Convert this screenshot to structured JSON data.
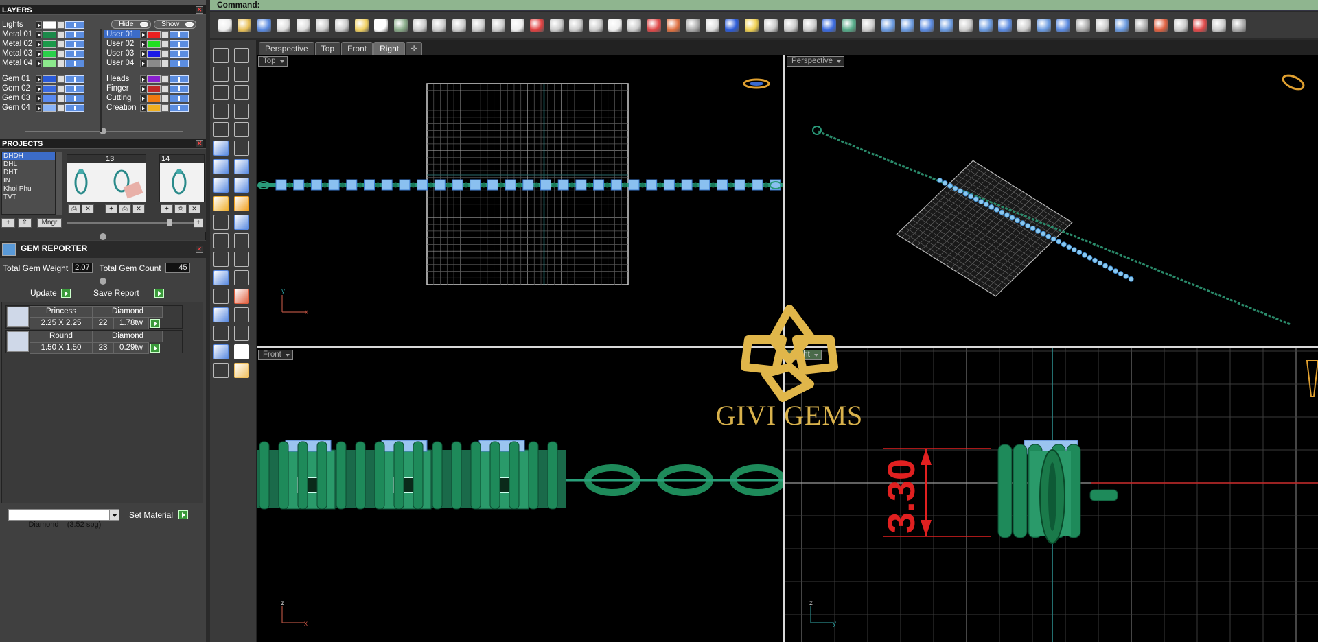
{
  "command": {
    "label": "Command:"
  },
  "layers": {
    "title": "LAYERS",
    "lights_label": "Lights",
    "hide_label": "Hide",
    "show_label": "Show",
    "left": [
      {
        "name": "Metal 01",
        "color": "#1c8a4a"
      },
      {
        "name": "Metal 02",
        "color": "#1c9a4a"
      },
      {
        "name": "Metal 03",
        "color": "#2ad04a"
      },
      {
        "name": "Metal 04",
        "color": "#8ce88c"
      },
      {
        "name": "Gem 01",
        "color": "#2a5ad8"
      },
      {
        "name": "Gem 02",
        "color": "#3a6ae0"
      },
      {
        "name": "Gem 03",
        "color": "#5a8af0"
      },
      {
        "name": "Gem 04",
        "color": "#8ab4f8"
      }
    ],
    "right": [
      {
        "name": "User 01",
        "color": "#e82020",
        "selected": true
      },
      {
        "name": "User 02",
        "color": "#20e020"
      },
      {
        "name": "User 03",
        "color": "#1a1ae8"
      },
      {
        "name": "User 04",
        "color": "#8a8a8a"
      },
      {
        "name": "Heads",
        "color": "#8a20d0"
      },
      {
        "name": "Finger",
        "color": "#c02828"
      },
      {
        "name": "Cutting",
        "color": "#f07a10"
      },
      {
        "name": "Creation",
        "color": "#f0b020"
      }
    ]
  },
  "projects": {
    "title": "PROJECTS",
    "items": [
      "DHDH",
      "DHL",
      "DHT",
      "IN",
      "Khoi Phu",
      "TVT"
    ],
    "thumbs": [
      "",
      "13",
      "14"
    ],
    "mngr_label": "Mngr"
  },
  "gem_reporter": {
    "title": "GEM REPORTER",
    "total_weight_label": "Total Gem Weight",
    "total_weight": "2.07",
    "total_count_label": "Total Gem Count",
    "total_count": "45",
    "update_label": "Update",
    "save_label": "Save Report",
    "rows": [
      {
        "shape": "Princess",
        "material": "Diamond",
        "size": "2.25 X 2.25",
        "count": "22",
        "weight": "1.78tw"
      },
      {
        "shape": "Round",
        "material": "Diamond",
        "size": "1.50 X 1.50",
        "count": "23",
        "weight": "0.29tw"
      }
    ],
    "material_select": "Diamond    (3.52 spg)",
    "set_material_label": "Set Material"
  },
  "viewport_tabs": [
    "Perspective",
    "Top",
    "Front",
    "Right"
  ],
  "active_tab": "Right",
  "viewports": {
    "top": "Top",
    "perspective": "Perspective",
    "front": "Front",
    "right": "Right"
  },
  "dimension": "3.30",
  "watermark": "GIVI GEMS"
}
